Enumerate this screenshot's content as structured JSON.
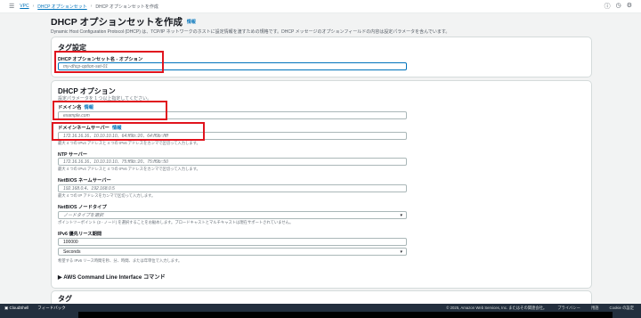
{
  "breadcrumb": {
    "vpc": "VPC",
    "dhcp_sets": "DHCP オプションセット",
    "current": "DHCP オプションセットを作成"
  },
  "page": {
    "title": "DHCP オプションセットを作成",
    "title_info": "情報",
    "description": "Dynamic Host Configuration Protocol (DHCP) は、TCP/IP ネットワークのホストに設定情報を渡すための規格です。DHCP メッセージのオプションフィールドの内容は設定パラメータを含んでいます。"
  },
  "tag_settings": {
    "heading": "タグ設定",
    "name_label": "DHCP オプションセット名 - オプション",
    "name_placeholder": "my-dhcp-option-set-01"
  },
  "dhcp_options": {
    "heading": "DHCP オプション",
    "subheading": "設定パラメータを 1 つ以上指定してください。",
    "domain_name": {
      "label": "ドメイン名",
      "info": "情報",
      "placeholder": "example.com"
    },
    "dns_servers": {
      "label": "ドメインネームサーバー",
      "info": "情報",
      "placeholder": "172.16.16.16、10.10.10.10、64:ff9b::20、64:ff9b::ffff",
      "help": "最大 4 つの IPv4 アドレスと 4 つの IPv6 アドレスをカンマで区切って入力します。"
    },
    "ntp_servers": {
      "label": "NTP サーバー",
      "placeholder": "172.16.16.16、10.10.10.10、75:ff9b::20、75:ff9b::50",
      "help": "最大 4 つの IPv4 アドレスと 4 つの IPv6 アドレスをカンマで区切って入力します。"
    },
    "netbios_servers": {
      "label": "NetBIOS ネームサーバー",
      "placeholder": "192.168.0.4、192.168.0.5",
      "help": "最大 4 つの IP アドレスをカンマで区切って入力します。"
    },
    "netbios_node_type": {
      "label": "NetBIOS ノードタイプ",
      "placeholder": "ノードタイプを選択",
      "help": "ポイントツーポイント (2 - ノード) を選択することをお勧めします。ブロードキャストとマルチキャストは現在サポートされていません。"
    },
    "ipv6_lease": {
      "label": "IPv6 優先リース期間",
      "value": "100000",
      "unit": "Seconds",
      "help": "希望する IPv6 リース時間を秒、分、時間、または年単位で入力します。"
    },
    "cli_section": "AWS Command Line Interface コマンド"
  },
  "tags": {
    "heading": "タグ"
  },
  "footer": {
    "cloudshell": "CloudShell",
    "feedback": "フィードバック",
    "copyright": "© 2025, Amazon Web Services, Inc. またはその関連会社。",
    "privacy": "プライバシー",
    "terms": "用語",
    "cookie": "Cookie の設定"
  }
}
